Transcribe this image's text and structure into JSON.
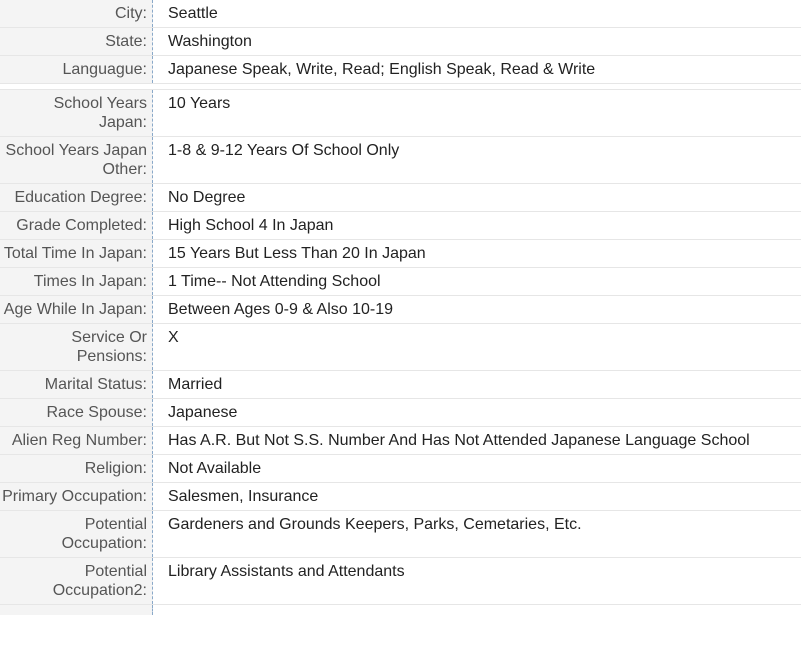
{
  "fields": [
    {
      "label": "City:",
      "value": "Seattle"
    },
    {
      "label": "State:",
      "value": "Washington"
    },
    {
      "label": "Languague:",
      "value": "Japanese Speak, Write, Read; English Speak, Read & Write"
    },
    {
      "label": "School Years Japan:",
      "value": "10 Years"
    },
    {
      "label": "School Years Japan Other:",
      "value": "1-8 & 9-12 Years Of School Only"
    },
    {
      "label": "Education Degree:",
      "value": "No Degree"
    },
    {
      "label": "Grade Completed:",
      "value": "High School 4 In Japan"
    },
    {
      "label": "Total Time In Japan:",
      "value": "15 Years But Less Than 20 In Japan"
    },
    {
      "label": "Times In Japan:",
      "value": "1 Time-- Not Attending School"
    },
    {
      "label": "Age While In Japan:",
      "value": "Between Ages 0-9 & Also 10-19"
    },
    {
      "label": "Service Or Pensions:",
      "value": "X"
    },
    {
      "label": "Marital Status:",
      "value": "Married"
    },
    {
      "label": "Race Spouse:",
      "value": "Japanese"
    },
    {
      "label": "Alien Reg Number:",
      "value": "Has A.R. But Not S.S. Number And Has Not Attended Japanese Language School"
    },
    {
      "label": "Religion:",
      "value": "Not Available"
    },
    {
      "label": "Primary Occupation:",
      "value": "Salesmen, Insurance"
    },
    {
      "label": "Potential Occupation:",
      "value": "Gardeners and Grounds Keepers, Parks, Cemetaries, Etc."
    },
    {
      "label": "Potential Occupation2:",
      "value": "Library Assistants and Attendants"
    }
  ]
}
